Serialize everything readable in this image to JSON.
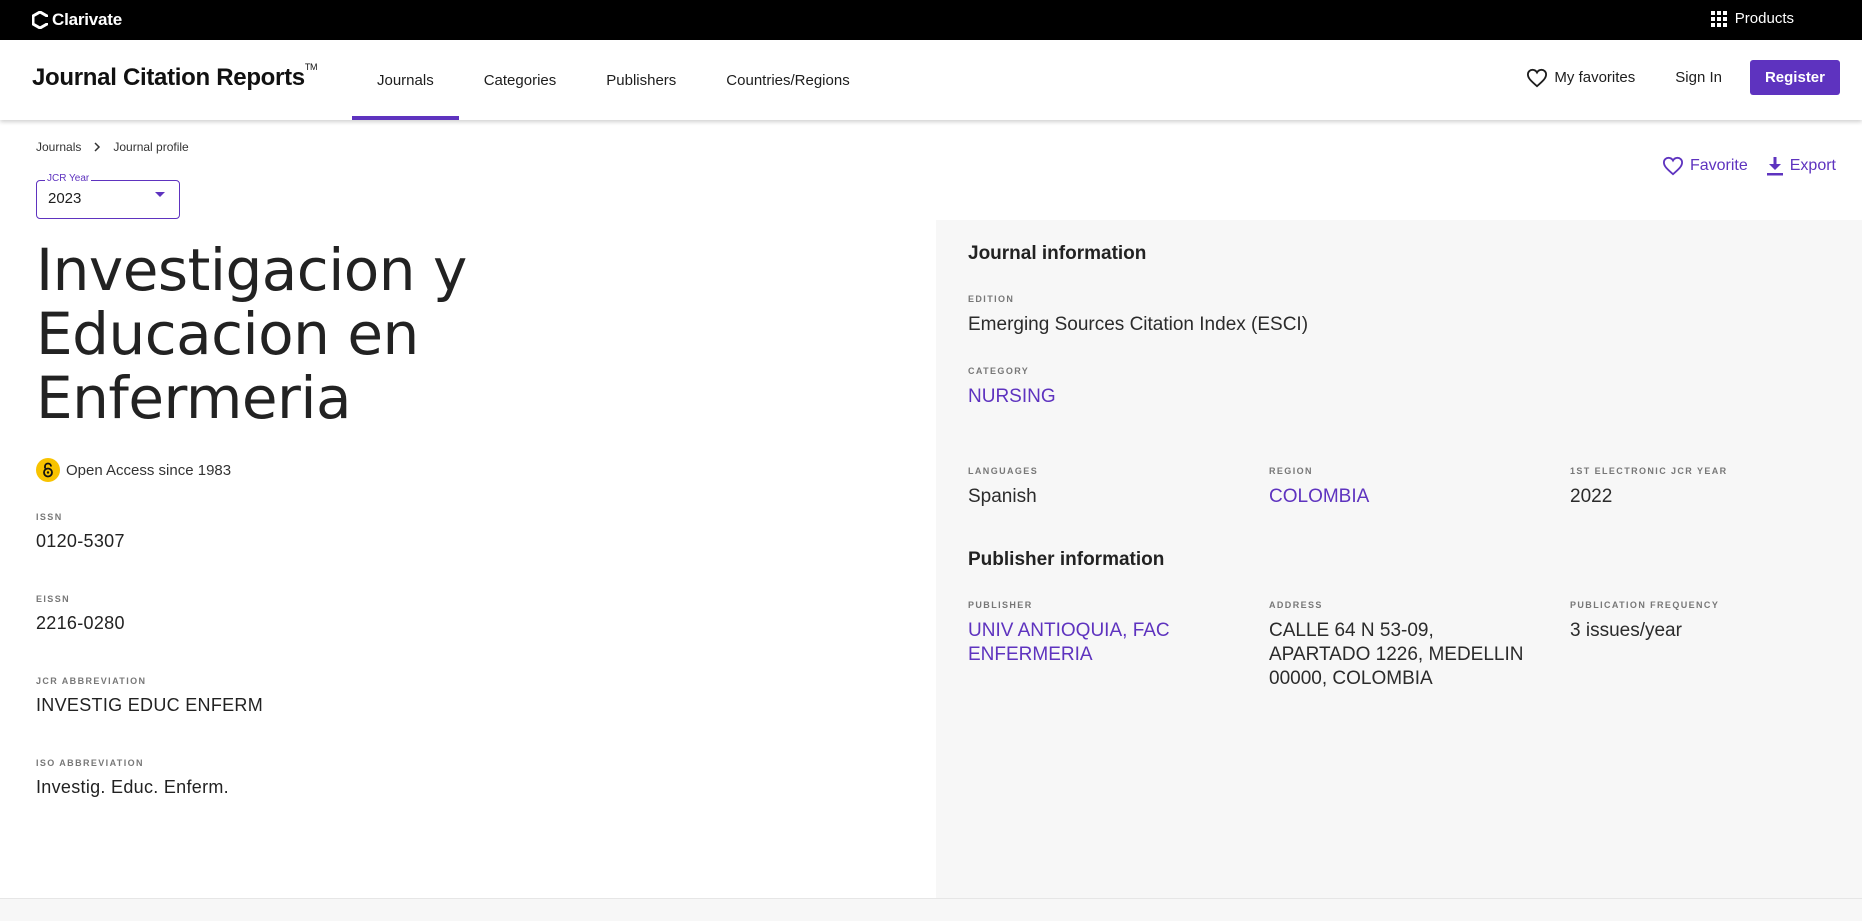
{
  "topbar": {
    "brand": "Clarivate",
    "products": "Products"
  },
  "header": {
    "title": "Journal Citation Reports",
    "trademark": "TM",
    "nav": [
      {
        "label": "Journals",
        "active": true
      },
      {
        "label": "Categories",
        "active": false
      },
      {
        "label": "Publishers",
        "active": false
      },
      {
        "label": "Countries/Regions",
        "active": false
      }
    ],
    "favorites": "My favorites",
    "sign_in": "Sign In",
    "register": "Register"
  },
  "breadcrumb": {
    "root": "Journals",
    "current": "Journal profile"
  },
  "year_select": {
    "label": "JCR Year",
    "value": "2023"
  },
  "actions": {
    "favorite": "Favorite",
    "export": "Export"
  },
  "journal": {
    "title": "Investigacion y Educacion en Enfermeria",
    "open_access": "Open Access since 1983",
    "issn": {
      "label": "ISSN",
      "value": "0120-5307"
    },
    "eissn": {
      "label": "EISSN",
      "value": "2216-0280"
    },
    "jcr_abbrev": {
      "label": "JCR ABBREVIATION",
      "value": "INVESTIG EDUC ENFERM"
    },
    "iso_abbrev": {
      "label": "ISO ABBREVIATION",
      "value": "Investig. Educ. Enferm."
    }
  },
  "journal_info": {
    "title": "Journal information",
    "edition": {
      "label": "EDITION",
      "value": "Emerging Sources Citation Index (ESCI)"
    },
    "category": {
      "label": "CATEGORY",
      "value": "NURSING"
    },
    "languages": {
      "label": "LANGUAGES",
      "value": "Spanish"
    },
    "region": {
      "label": "REGION",
      "value": "COLOMBIA"
    },
    "first_year": {
      "label": "1ST ELECTRONIC JCR YEAR",
      "value": "2022"
    }
  },
  "publisher_info": {
    "title": "Publisher information",
    "publisher": {
      "label": "PUBLISHER",
      "value": "UNIV ANTIOQUIA, FAC ENFERMERIA"
    },
    "address": {
      "label": "ADDRESS",
      "value": "CALLE 64 N 53-09, APARTADO 1226, MEDELLIN 00000, COLOMBIA"
    },
    "frequency": {
      "label": "PUBLICATION FREQUENCY",
      "value": "3 issues/year"
    }
  },
  "colors": {
    "accent": "#5e33bf",
    "open_access": "#f8c300",
    "panel_bg": "#f7f7f7"
  }
}
